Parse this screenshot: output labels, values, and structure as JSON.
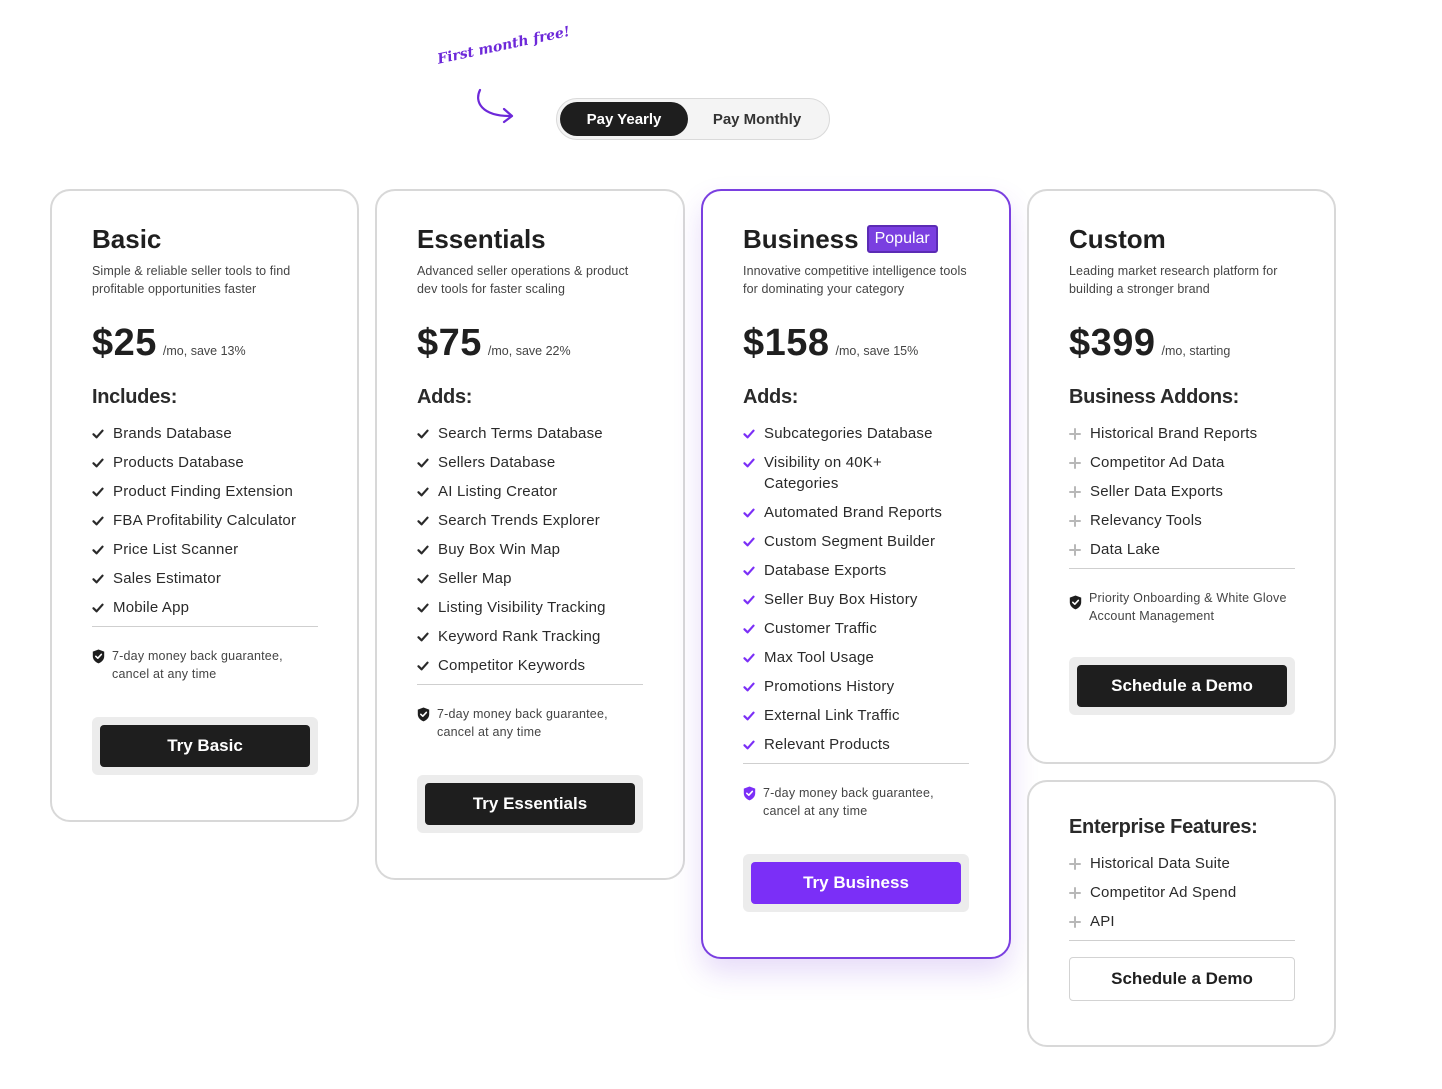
{
  "promo": {
    "text": "First month free!"
  },
  "billing_toggle": {
    "yearly_label": "Pay Yearly",
    "monthly_label": "Pay Monthly"
  },
  "colors": {
    "accent": "#7b2ff7",
    "dark": "#1e1e1e",
    "border": "#d8d8d8"
  },
  "plans": [
    {
      "title": "Basic",
      "subtitle": "Simple & reliable seller tools to find profitable opportunities faster",
      "price": "$25",
      "price_note": "/mo, save 13%",
      "section": "Includes:",
      "feature_icon": "check-icon",
      "features": [
        "Brands Database",
        "Products Database",
        "Product Finding Extension",
        "FBA Profitability Calculator",
        "Price List Scanner",
        "Sales Estimator",
        "Mobile App"
      ],
      "guarantee": "7-day money back guarantee, cancel at any time",
      "cta": "Try Basic"
    },
    {
      "title": "Essentials",
      "subtitle": "Advanced seller operations & product dev tools for faster scaling",
      "price": "$75",
      "price_note": "/mo, save 22%",
      "section": "Adds:",
      "feature_icon": "check-icon",
      "features": [
        "Search Terms Database",
        "Sellers Database",
        "AI Listing Creator",
        "Search Trends Explorer",
        "Buy Box Win Map",
        "Seller Map",
        "Listing Visibility Tracking",
        "Keyword Rank Tracking",
        "Competitor Keywords"
      ],
      "guarantee": "7-day money back guarantee, cancel at any time",
      "cta": "Try Essentials"
    },
    {
      "title": "Business",
      "badge": "Popular",
      "subtitle": "Innovative competitive intelligence tools for dominating your category",
      "price": "$158",
      "price_note": "/mo, save 15%",
      "section": "Adds:",
      "feature_icon": "check-icon",
      "features": [
        "Subcategories Database",
        "Visibility on 40K+ Categories",
        "Automated Brand Reports",
        "Custom Segment Builder",
        "Database Exports",
        "Seller Buy Box History",
        "Customer Traffic",
        "Max Tool Usage",
        "Promotions History",
        "External Link Traffic",
        "Relevant Products"
      ],
      "guarantee": "7-day money back guarantee, cancel at any time",
      "cta": "Try Business"
    },
    {
      "title": "Custom",
      "subtitle": "Leading market research platform for building a stronger brand",
      "price": "$399",
      "price_note": "/mo, starting",
      "section": "Business Addons:",
      "feature_icon": "plus-icon",
      "features": [
        "Historical Brand Reports",
        "Competitor Ad Data",
        "Seller Data Exports",
        "Relevancy Tools",
        "Data Lake"
      ],
      "guarantee": "Priority Onboarding & White Glove Account Management",
      "cta": "Schedule a Demo"
    }
  ],
  "enterprise": {
    "section": "Enterprise Features:",
    "features": [
      "Historical Data Suite",
      "Competitor Ad Spend",
      "API"
    ],
    "cta": "Schedule a Demo"
  }
}
